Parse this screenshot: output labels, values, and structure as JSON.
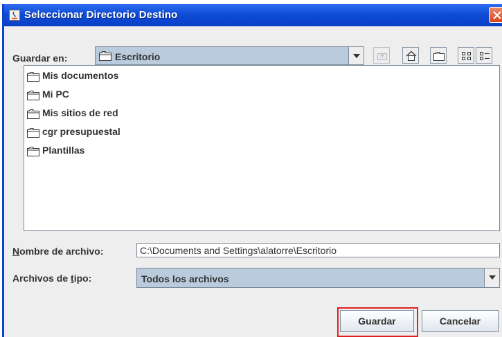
{
  "window": {
    "title": "Seleccionar Directorio Destino"
  },
  "look_in": {
    "label": "Guardar en:",
    "value": "Escritorio"
  },
  "toolbar": {
    "icons": [
      "up-folder-icon",
      "home-icon",
      "new-folder-icon",
      "list-view-icon",
      "details-view-icon"
    ]
  },
  "files": [
    {
      "name": "Mis documentos",
      "icon": "folder-icon"
    },
    {
      "name": "Mi PC",
      "icon": "folder-icon"
    },
    {
      "name": "Mis sitios de red",
      "icon": "folder-icon"
    },
    {
      "name": "cgr presupuestal",
      "icon": "folder-icon"
    },
    {
      "name": "Plantillas",
      "icon": "folder-icon"
    }
  ],
  "filename": {
    "label_mnemonic": "N",
    "label_rest": "ombre de archivo:",
    "value": "C:\\Documents and Settings\\alatorre\\Escritorio"
  },
  "filetype": {
    "label_start": "Archivos de ",
    "label_mnemonic": "t",
    "label_end": "ipo:",
    "value": "Todos los archivos"
  },
  "buttons": {
    "save": "Guardar",
    "cancel": "Cancelar"
  },
  "colors": {
    "titlebar": "#0e4cd6",
    "combo_background": "#b9cbdd",
    "highlight": "#e02020"
  }
}
